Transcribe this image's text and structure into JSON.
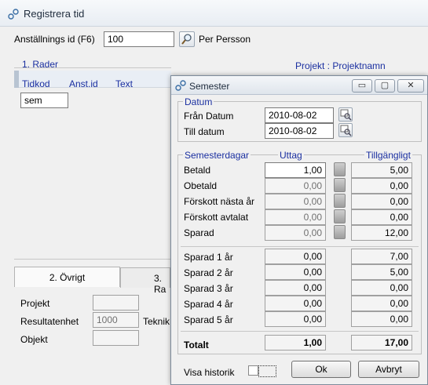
{
  "window": {
    "title": "Registrera tid"
  },
  "main": {
    "employee_label": "Anställnings id (F6)",
    "employee_value": "100",
    "person_label": "Per Persson",
    "section_rows": "1. Rader",
    "project_label": "Projekt : Projektnamn",
    "columns": [
      "Tidkod",
      "Anst.id",
      "Text"
    ],
    "row_value": "sem",
    "tabs": [
      "2. Övrigt",
      "3. Ra"
    ],
    "fields": {
      "project": "Projekt",
      "result_unit": "Resultatenhet",
      "result_unit_value": "1000",
      "technique": "Teknik",
      "object": "Objekt"
    }
  },
  "dialog": {
    "title": "Semester",
    "win_buttons": {
      "minimize": "▭",
      "maximize": "▢",
      "close": "✕"
    },
    "datum": {
      "group_label": "Datum",
      "from_label": "Från Datum",
      "from_value": "2010-08-02",
      "to_label": "Till datum",
      "to_value": "2010-08-02"
    },
    "vacation": {
      "group_label": "Semesterdagar",
      "col_withdraw": "Uttag",
      "col_available": "Tillgängligt",
      "rows": [
        {
          "label": "Betald",
          "withdraw": "1,00",
          "available": "5,00"
        },
        {
          "label": "Obetald",
          "withdraw": "0,00",
          "available": "0,00"
        },
        {
          "label": "Förskott nästa år",
          "withdraw": "0,00",
          "available": "0,00"
        },
        {
          "label": "Förskott avtalat",
          "withdraw": "0,00",
          "available": "0,00"
        },
        {
          "label": "Sparad",
          "withdraw": "0,00",
          "available": "12,00"
        }
      ],
      "saved_rows": [
        {
          "label": "Sparad 1 år",
          "withdraw": "0,00",
          "available": "7,00"
        },
        {
          "label": "Sparad 2 år",
          "withdraw": "0,00",
          "available": "5,00"
        },
        {
          "label": "Sparad 3 år",
          "withdraw": "0,00",
          "available": "0,00"
        },
        {
          "label": "Sparad 4 år",
          "withdraw": "0,00",
          "available": "0,00"
        },
        {
          "label": "Sparad 5 år",
          "withdraw": "0,00",
          "available": "0,00"
        }
      ],
      "total_label": "Totalt",
      "total_withdraw": "1,00",
      "total_available": "17,00"
    },
    "history_label": "Visa historik",
    "ok_label": "Ok",
    "cancel_label": "Avbryt"
  }
}
